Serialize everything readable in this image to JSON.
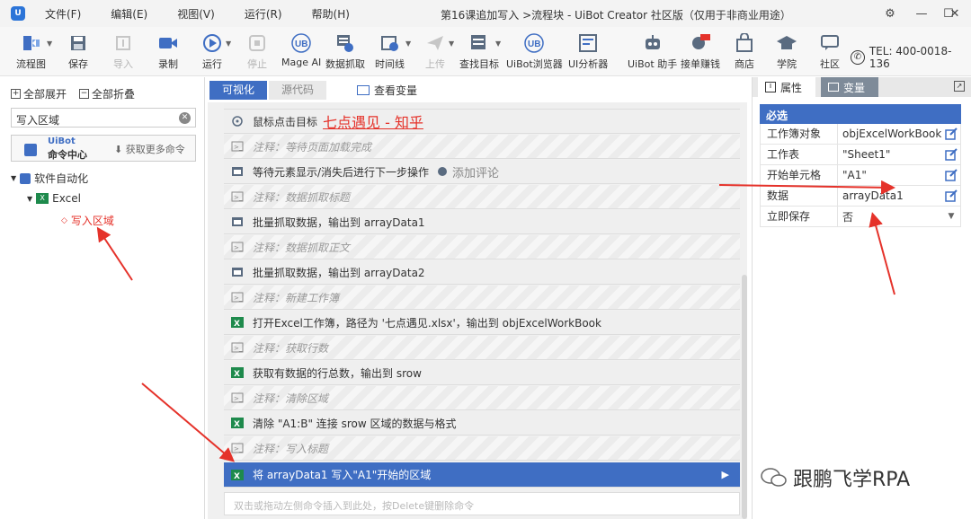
{
  "title_bar": {
    "menu": [
      "文件(F)",
      "编辑(E)",
      "视图(V)",
      "运行(R)",
      "帮助(H)"
    ],
    "window_title": "第16课追加写入 >流程块 - UiBot Creator 社区版（仅用于非商业用途）"
  },
  "toolbar": {
    "buttons": [
      "流程图",
      "保存",
      "导入",
      "录制",
      "运行",
      "停止",
      "Mage AI",
      "数据抓取",
      "时间线",
      "上传",
      "查找目标",
      "UiBot浏览器",
      "UI分析器",
      "UiBot 助手",
      "接单赚钱",
      "商店",
      "学院",
      "社区"
    ],
    "tel": "TEL: 400-0018-136"
  },
  "left_panel": {
    "expand_all": "全部展开",
    "collapse_all": "全部折叠",
    "search_value": "写入区域",
    "command_center_brand": "UiBot",
    "command_center_label": "命令中心",
    "get_more": "获取更多命令",
    "tree": [
      "软件自动化",
      "Excel",
      "写入区域"
    ]
  },
  "middle_panel": {
    "tab_visual": "可视化",
    "tab_source": "源代码",
    "view_vars": "查看变量",
    "row_click_prefix": "鼠标点击目标",
    "row_click_target": "七点遇见 - 知乎",
    "rows": [
      "注释：等待页面加载完成",
      "等待元素显示/消失后进行下一步操作",
      "注释：数据抓取标题",
      "批量抓取数据，输出到 arrayData1",
      "注释：数据抓取正文",
      "批量抓取数据，输出到 arrayData2",
      "注释：新建工作簿",
      "打开Excel工作簿，路径为 '七点遇见.xlsx'，输出到 objExcelWorkBook",
      "注释：获取行数",
      "获取有数据的行总数，输出到 srow",
      "注释：清除区域",
      "清除 \"A1:B\" 连接 srow 区域的数据与格式",
      "注释：写入标题",
      "将 arrayData1 写入\"A1\"开始的区域"
    ],
    "add_comment": "添加评论",
    "hint": "双击或拖动左侧命令插入到此处，按Delete键删除命令"
  },
  "right_panel": {
    "tab_props": "属性",
    "tab_vars": "变量",
    "section": "必选",
    "props": [
      {
        "key": "工作簿对象",
        "value": "objExcelWorkBook"
      },
      {
        "key": "工作表",
        "value": "\"Sheet1\""
      },
      {
        "key": "开始单元格",
        "value": "\"A1\""
      },
      {
        "key": "数据",
        "value": "arrayData1"
      },
      {
        "key": "立即保存",
        "value": "否"
      }
    ]
  },
  "watermark": "跟鹏飞学RPA",
  "colors": {
    "accent": "#3f6ec3",
    "arrow": "#e5322a",
    "link": "#e5322a",
    "excel": "#1e8a4c"
  }
}
